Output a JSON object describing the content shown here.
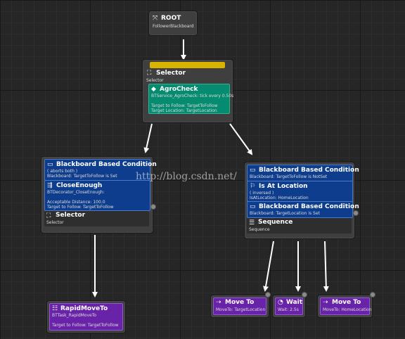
{
  "root": {
    "title": "ROOT",
    "sub": "FollowerBlackboard"
  },
  "selector_top": {
    "title": "Selector",
    "sub": "Selector",
    "accent_color": "#d8b400",
    "service": {
      "title": "AgroCheck",
      "sub": "BTService_AgroCheck: tick every 0.50s",
      "line1": "Target to Follow: TargetToFollow",
      "line2": "Target Location: TargetLocation"
    }
  },
  "left_branch": {
    "decorator1": {
      "title": "Blackboard Based Condition",
      "sub1": "( aborts both )",
      "sub2": "Blackboard: TargetToFollow is Set"
    },
    "decorator2": {
      "title": "CloseEnough",
      "sub1": "BTDecorator_CloseEnough:",
      "sub2": "Acceptable Distance: 100.0",
      "sub3": "Target to Follow: TargetToFollow"
    },
    "composite": {
      "title": "Selector",
      "sub": "Selector"
    }
  },
  "right_branch": {
    "decorator1": {
      "title": "Blackboard Based Condition",
      "sub": "Blackboard: TargetToFollow is NotSet"
    },
    "decorator2": {
      "title": "Is At Location",
      "sub1": "( inversed )",
      "sub2": "IsAtLocation: HomeLocation"
    },
    "decorator3": {
      "title": "Blackboard Based Condition",
      "sub": "Blackboard: TargetLocation is Set"
    },
    "composite": {
      "title": "Sequence",
      "sub": "Sequence"
    }
  },
  "tasks": {
    "rapid_move": {
      "title": "RapidMoveTo",
      "sub1": "BTTask_RapidMoveTo",
      "sub2": "Target to Follow: TargetToFollow"
    },
    "move_to_target": {
      "title": "Move To",
      "sub": "MoveTo: TargetLocation"
    },
    "wait": {
      "title": "Wait",
      "sub": "Wait: 2.5s"
    },
    "move_to_home": {
      "title": "Move To",
      "sub": "MoveTo: HomeLocation"
    }
  },
  "watermark": "http://blog.csdn.net/",
  "colors": {
    "decorator": "#0d3d8c",
    "service": "#058b6f",
    "task": "#6923a8",
    "node": "#3f3f3f",
    "background": "#262626"
  }
}
